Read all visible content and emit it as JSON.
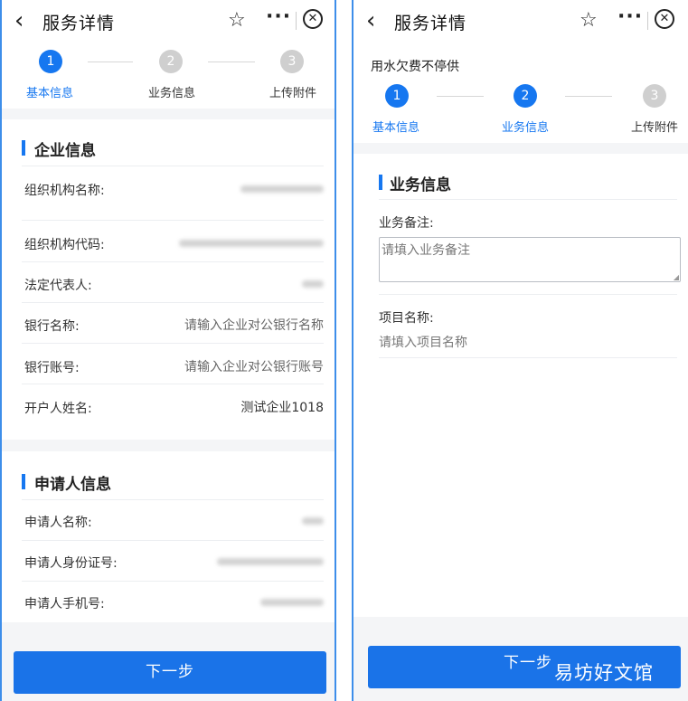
{
  "left": {
    "header": {
      "title": "服务详情"
    },
    "steps": [
      {
        "number": "1",
        "label": "基本信息",
        "state": "active"
      },
      {
        "number": "2",
        "label": "业务信息",
        "state": "inactive"
      },
      {
        "number": "3",
        "label": "上传附件",
        "state": "inactive"
      }
    ],
    "company_section": {
      "title": "企业信息",
      "rows": [
        {
          "label": "组织机构名称:",
          "value": ""
        },
        {
          "label": "组织机构代码:",
          "value": ""
        },
        {
          "label": "法定代表人:",
          "value": ""
        },
        {
          "label": "银行名称:",
          "value": "请输入企业对公银行名称"
        },
        {
          "label": "银行账号:",
          "value": "请输入企业对公银行账号"
        },
        {
          "label": "开户人姓名:",
          "value": "测试企业1018"
        }
      ]
    },
    "applicant_section": {
      "title": "申请人信息",
      "rows": [
        {
          "label": "申请人名称:",
          "value": ""
        },
        {
          "label": "申请人身份证号:",
          "value": ""
        },
        {
          "label": "申请人手机号:",
          "value": ""
        }
      ]
    },
    "next_button": "下一步"
  },
  "right": {
    "header": {
      "title": "服务详情"
    },
    "service_name": "用水欠费不停供",
    "steps": [
      {
        "number": "1",
        "label": "基本信息",
        "state": "active"
      },
      {
        "number": "2",
        "label": "业务信息",
        "state": "active"
      },
      {
        "number": "3",
        "label": "上传附件",
        "state": "inactive"
      }
    ],
    "business_section": {
      "title": "业务信息",
      "remark_label": "业务备注:",
      "remark_placeholder": "请填入业务备注",
      "project_label": "项目名称:",
      "project_placeholder": "请填入项目名称"
    },
    "next_button": "下一步"
  },
  "watermark": "易坊好文馆",
  "colors": {
    "accent": "#1677f0",
    "button": "#1a73e8",
    "inactive_step": "#cfcfcf",
    "band": "#f4f5f7"
  },
  "icons": [
    "chevron-left-icon",
    "star-icon",
    "more-icon",
    "close-circle-icon"
  ]
}
